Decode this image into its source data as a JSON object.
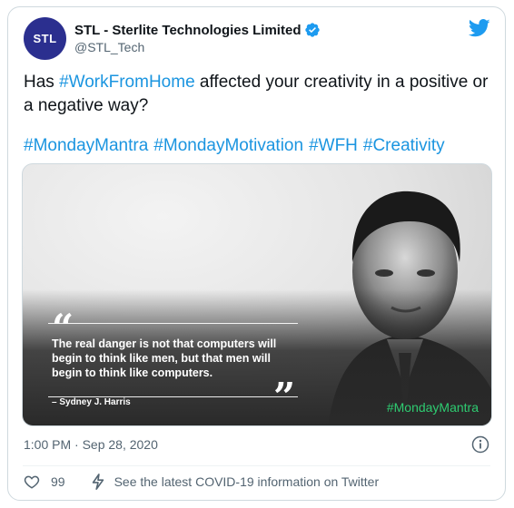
{
  "author": {
    "name": "STL - Sterlite Technologies Limited",
    "handle": "@STL_Tech",
    "avatar_text": "STL"
  },
  "tweet": {
    "text_before": "Has ",
    "text_hashtag": "#WorkFromHome",
    "text_after": " affected your creativity in a positive or a negative way?",
    "hashtags": [
      "#MondayMantra",
      "#MondayMotivation",
      "#WFH",
      "#Creativity"
    ]
  },
  "media": {
    "quote": "The real danger is not that computers will begin to think like men, but that men will begin to think like computers.",
    "author": "– Sydney J. Harris",
    "hashtag": "#MondayMantra"
  },
  "footer": {
    "timestamp": "1:00 PM · Sep 28, 2020",
    "like_count": "99",
    "covid_link": "See the latest COVID-19 information on Twitter"
  },
  "colors": {
    "link": "#1b95e0",
    "avatar_bg": "#2b2f8f",
    "verified": "#1d9bf0",
    "media_hashtag": "#2ecc71"
  },
  "icons": [
    "verified-badge-icon",
    "twitter-bird-icon",
    "info-icon",
    "heart-icon",
    "bolt-icon"
  ]
}
